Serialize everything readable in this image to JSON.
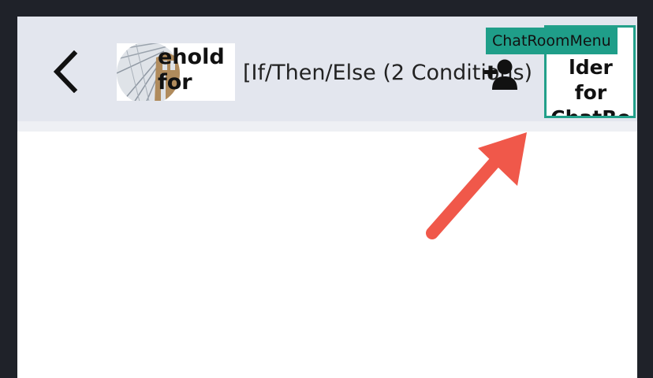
{
  "header": {
    "title": "[If/Then/Else (2 Conditions)",
    "avatar_alt": "ehold\nfor"
  },
  "menu": {
    "label": "ChatRoomMenu",
    "alt_text": "lder for\nChatRo\nM"
  },
  "icons": {
    "back": "chevron-left-icon",
    "add_user": "add-user-icon",
    "annotation": "arrow-annotation"
  },
  "colors": {
    "background": "#1f2229",
    "header": "#e3e6ee",
    "menu_highlight": "#1f9e89",
    "arrow": "#f0584a"
  }
}
